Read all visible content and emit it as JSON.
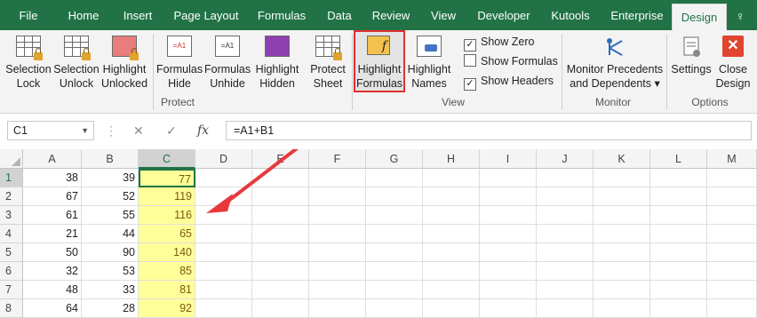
{
  "tabs": [
    "File",
    "Home",
    "Insert",
    "Page Layout",
    "Formulas",
    "Data",
    "Review",
    "View",
    "Developer",
    "Kutools",
    "Enterprise",
    "Design"
  ],
  "help_icon": "lightbulb-icon",
  "ribbon": {
    "buttons": [
      {
        "id": "selection-lock",
        "l1": "Selection",
        "l2": "Lock"
      },
      {
        "id": "selection-unlock",
        "l1": "Selection",
        "l2": "Unlock"
      },
      {
        "id": "highlight-unlocked",
        "l1": "Highlight",
        "l2": "Unlocked"
      },
      {
        "id": "formulas-hide",
        "l1": "Formulas",
        "l2": "Hide"
      },
      {
        "id": "formulas-unhide",
        "l1": "Formulas",
        "l2": "Unhide"
      },
      {
        "id": "highlight-hidden",
        "l1": "Highlight",
        "l2": "Hidden"
      },
      {
        "id": "protect-sheet",
        "l1": "Protect",
        "l2": "Sheet"
      },
      {
        "id": "highlight-formulas",
        "l1": "Highlight",
        "l2": "Formulas"
      },
      {
        "id": "highlight-names",
        "l1": "Highlight",
        "l2": "Names"
      },
      {
        "id": "monitor-precedents",
        "l1": "Monitor Precedents",
        "l2": "and Dependents ▾"
      },
      {
        "id": "settings",
        "l1": "Settings",
        "l2": ""
      },
      {
        "id": "close-design",
        "l1": "Close",
        "l2": "Design"
      }
    ],
    "checkboxes": [
      {
        "label": "Show Zero",
        "checked": true
      },
      {
        "label": "Show Formulas",
        "checked": false
      },
      {
        "label": "Show Headers",
        "checked": true
      }
    ],
    "groups": [
      "Protect",
      "View",
      "Monitor",
      "Options"
    ]
  },
  "formula_bar": {
    "name_box": "C1",
    "cancel": "✕",
    "enter": "✓",
    "fx": "fx",
    "formula": "=A1+B1"
  },
  "columns": [
    "A",
    "B",
    "C",
    "D",
    "E",
    "F",
    "G",
    "H",
    "I",
    "J",
    "K",
    "L",
    "M"
  ],
  "rows": [
    "1",
    "2",
    "3",
    "4",
    "5",
    "6",
    "7",
    "8"
  ],
  "data": [
    [
      "38",
      "39",
      "77"
    ],
    [
      "67",
      "52",
      "119"
    ],
    [
      "61",
      "55",
      "116"
    ],
    [
      "21",
      "44",
      "65"
    ],
    [
      "50",
      "90",
      "140"
    ],
    [
      "32",
      "53",
      "85"
    ],
    [
      "48",
      "33",
      "81"
    ],
    [
      "64",
      "28",
      "92"
    ]
  ],
  "colors": {
    "accent": "#217346",
    "highlight": "#ffff99",
    "arrow": "#e8383d"
  }
}
